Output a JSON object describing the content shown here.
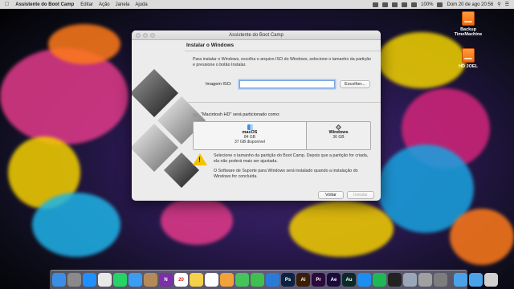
{
  "menubar": {
    "apple_icon": "apple-icon",
    "app_name": "Assistente do Boot Camp",
    "items": [
      "Editar",
      "Ação",
      "Janela",
      "Ajuda"
    ],
    "battery": "100%",
    "clock": "Dom 20 de ago  20:56"
  },
  "desktop": {
    "drives": [
      {
        "label": "Backup TimeMachine"
      },
      {
        "label": "HD JOEL"
      }
    ]
  },
  "window": {
    "title": "Assistente do Boot Camp",
    "section_title": "Instalar o Windows",
    "intro": "Para instalar o Windows, escolha o arquivo ISO do Windows, selecione o tamanho da partição e pressione o botão Instalar.",
    "iso_label": "Imagem ISO:",
    "iso_value": "",
    "choose_button": "Escolher...",
    "partition_caption": "\"Macintosh HD\" será particionado como:",
    "partitions": [
      {
        "name": "macOS",
        "size": "84 GB",
        "free": "37 GB disponível"
      },
      {
        "name": "Windows",
        "size": "36 GB"
      }
    ],
    "warning_1": "Selecione o tamanho da partição do Boot Camp. Depois que a partição for criada, ela não poderá mais ser ajustada.",
    "warning_2": "O Software de Suporte para Windows será instalado quando a instalação do Windows for concluída.",
    "back_button": "Voltar",
    "install_button": "Instalar"
  },
  "dock": {
    "apps": [
      {
        "name": "finder",
        "color": "#3a8ee6",
        "glyph": ""
      },
      {
        "name": "launchpad",
        "color": "#8a8a8a",
        "glyph": ""
      },
      {
        "name": "safari",
        "color": "#1e90ff",
        "glyph": ""
      },
      {
        "name": "chrome",
        "color": "#e8e8e8",
        "glyph": ""
      },
      {
        "name": "whatsapp",
        "color": "#25d366",
        "glyph": ""
      },
      {
        "name": "mail",
        "color": "#3b9cf0",
        "glyph": ""
      },
      {
        "name": "contacts",
        "color": "#b58a5a",
        "glyph": ""
      },
      {
        "name": "onenote",
        "color": "#7b2fa8",
        "glyph": "N"
      },
      {
        "name": "calendar",
        "color": "#ffffff",
        "glyph": "20"
      },
      {
        "name": "notes",
        "color": "#f5d04a",
        "glyph": ""
      },
      {
        "name": "reminders",
        "color": "#ffffff",
        "glyph": ""
      },
      {
        "name": "photos",
        "color": "#f2a23a",
        "glyph": ""
      },
      {
        "name": "messages",
        "color": "#46c35a",
        "glyph": ""
      },
      {
        "name": "facetime",
        "color": "#3fbf4f",
        "glyph": ""
      },
      {
        "name": "keynote",
        "color": "#2a7bd6",
        "glyph": ""
      },
      {
        "name": "photoshop",
        "color": "#0b2340",
        "glyph": "Ps"
      },
      {
        "name": "illustrator",
        "color": "#3a1e06",
        "glyph": "Ai"
      },
      {
        "name": "premiere",
        "color": "#2a0a3a",
        "glyph": "Pr"
      },
      {
        "name": "after-effects",
        "color": "#1a0a3a",
        "glyph": "Ae"
      },
      {
        "name": "audition",
        "color": "#0a2a2a",
        "glyph": "Au"
      },
      {
        "name": "app-store",
        "color": "#1c8ef0",
        "glyph": ""
      },
      {
        "name": "spotify",
        "color": "#1db954",
        "glyph": ""
      },
      {
        "name": "activity-monitor",
        "color": "#222222",
        "glyph": ""
      },
      {
        "name": "preview",
        "color": "#9aa7b8",
        "glyph": ""
      },
      {
        "name": "boot-camp",
        "color": "#a0a0a0",
        "glyph": ""
      },
      {
        "name": "system-preferences",
        "color": "#7d7d7d",
        "glyph": ""
      }
    ],
    "right": [
      {
        "name": "downloads-folder",
        "color": "#4aa3e8"
      },
      {
        "name": "documents-folder",
        "color": "#4aa3e8"
      },
      {
        "name": "trash",
        "color": "#d0d0d0"
      }
    ]
  }
}
